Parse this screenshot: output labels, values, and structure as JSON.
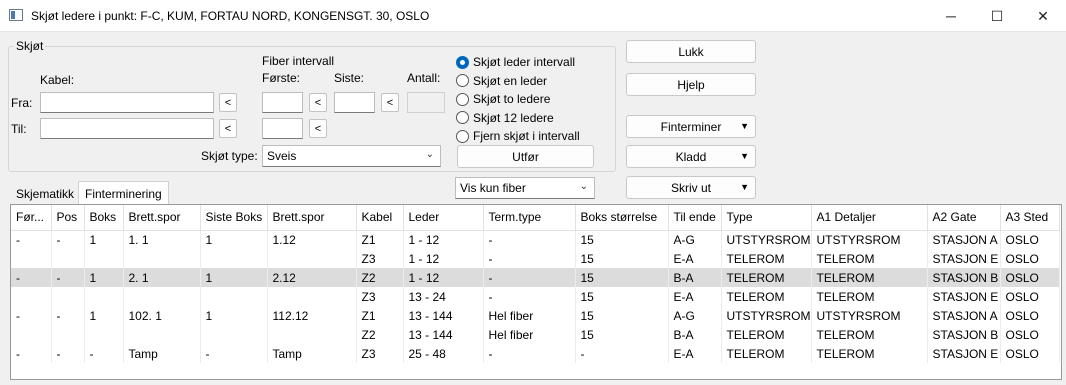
{
  "window": {
    "title": "Skjøt ledere i punkt: F-C, KUM, FORTAU NORD, KONGENSGT. 30, OSLO"
  },
  "skjot": {
    "group_label": "Skjøt",
    "kabel_label": "Kabel:",
    "fra_label": "Fra:",
    "til_label": "Til:",
    "fra_value": "",
    "til_value": "",
    "arrow": "<",
    "fiber_interval_label": "Fiber intervall",
    "forste_label": "Første:",
    "siste_label": "Siste:",
    "antall_label": "Antall:",
    "type_label": "Skjøt type:",
    "type_value": "Sveis"
  },
  "radios": [
    {
      "label": "Skjøt leder intervall",
      "selected": true
    },
    {
      "label": "Skjøt en leder",
      "selected": false
    },
    {
      "label": "Skjøt to ledere",
      "selected": false
    },
    {
      "label": "Skjøt 12 ledere",
      "selected": false
    },
    {
      "label": "Fjern skjøt i intervall",
      "selected": false
    }
  ],
  "buttons": {
    "utfor": "Utfør",
    "lukk": "Lukk",
    "hjelp": "Hjelp",
    "finterminer": "Finterminer",
    "kladd": "Kladd",
    "skriv_ut": "Skriv ut"
  },
  "filter": {
    "value": "Vis kun fiber"
  },
  "tabs": [
    {
      "label": "Skjematikk",
      "active": false
    },
    {
      "label": "Finterminering",
      "active": true
    }
  ],
  "table": {
    "columns": [
      "Før...",
      "Pos",
      "Boks",
      "Brett.spor",
      "Siste Boks",
      "Brett.spor",
      "Kabel",
      "Leder",
      "Term.type",
      "Boks størrelse",
      "Til ende",
      "Type",
      "A1 Detaljer",
      "A2 Gate",
      "A3 Sted"
    ],
    "rows": [
      {
        "selected": false,
        "cells": [
          "-",
          "-",
          "1",
          "1. 1",
          "1",
          "1.12",
          "Z1",
          "1 - 12",
          "-",
          "15",
          "A-G",
          "UTSTYRSROM",
          "UTSTYRSROM",
          "STASJON A",
          "OSLO"
        ]
      },
      {
        "selected": false,
        "cells": [
          "",
          "",
          "",
          "",
          "",
          "",
          "Z3",
          "1 - 12",
          "-",
          "15",
          "E-A",
          "TELEROM",
          "TELEROM",
          "STASJON E",
          "OSLO"
        ]
      },
      {
        "selected": true,
        "cells": [
          "-",
          "-",
          "1",
          "2. 1",
          "1",
          "2.12",
          "Z2",
          "1 - 12",
          "-",
          "15",
          "B-A",
          "TELEROM",
          "TELEROM",
          "STASJON B",
          "OSLO"
        ]
      },
      {
        "selected": false,
        "cells": [
          "",
          "",
          "",
          "",
          "",
          "",
          "Z3",
          "13 - 24",
          "-",
          "15",
          "E-A",
          "TELEROM",
          "TELEROM",
          "STASJON E",
          "OSLO"
        ]
      },
      {
        "selected": false,
        "cells": [
          "-",
          "-",
          "1",
          "102. 1",
          "1",
          "112.12",
          "Z1",
          "13 - 144",
          "Hel fiber",
          "15",
          "A-G",
          "UTSTYRSROM",
          "UTSTYRSROM",
          "STASJON A",
          "OSLO"
        ]
      },
      {
        "selected": false,
        "cells": [
          "",
          "",
          "",
          "",
          "",
          "",
          "Z2",
          "13 - 144",
          "Hel fiber",
          "15",
          "B-A",
          "TELEROM",
          "TELEROM",
          "STASJON B",
          "OSLO"
        ]
      },
      {
        "selected": false,
        "cells": [
          "-",
          "-",
          "-",
          "Tamp",
          "-",
          "Tamp",
          "Z3",
          "25 - 48",
          "-",
          "-",
          "E-A",
          "TELEROM",
          "TELEROM",
          "STASJON E",
          "OSLO"
        ]
      }
    ]
  }
}
